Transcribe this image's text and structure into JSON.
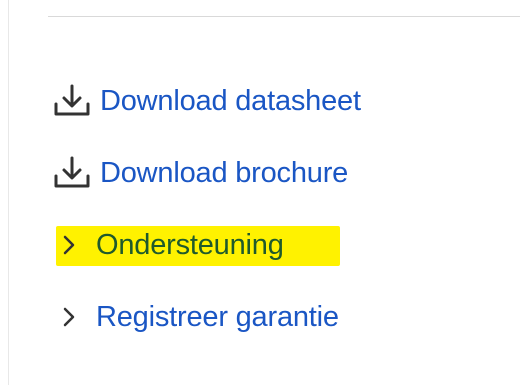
{
  "links": [
    {
      "label": "Download datasheet",
      "icon": "download-icon"
    },
    {
      "label": "Download brochure",
      "icon": "download-icon"
    },
    {
      "label": "Ondersteuning",
      "icon": "chevron-right-icon",
      "highlighted": true
    },
    {
      "label": "Registreer garantie",
      "icon": "chevron-right-icon"
    }
  ],
  "colors": {
    "link": "#1a56c4",
    "highlight": "#fff200",
    "highlighted_text": "#1f5a2c",
    "icon": "#333333"
  }
}
